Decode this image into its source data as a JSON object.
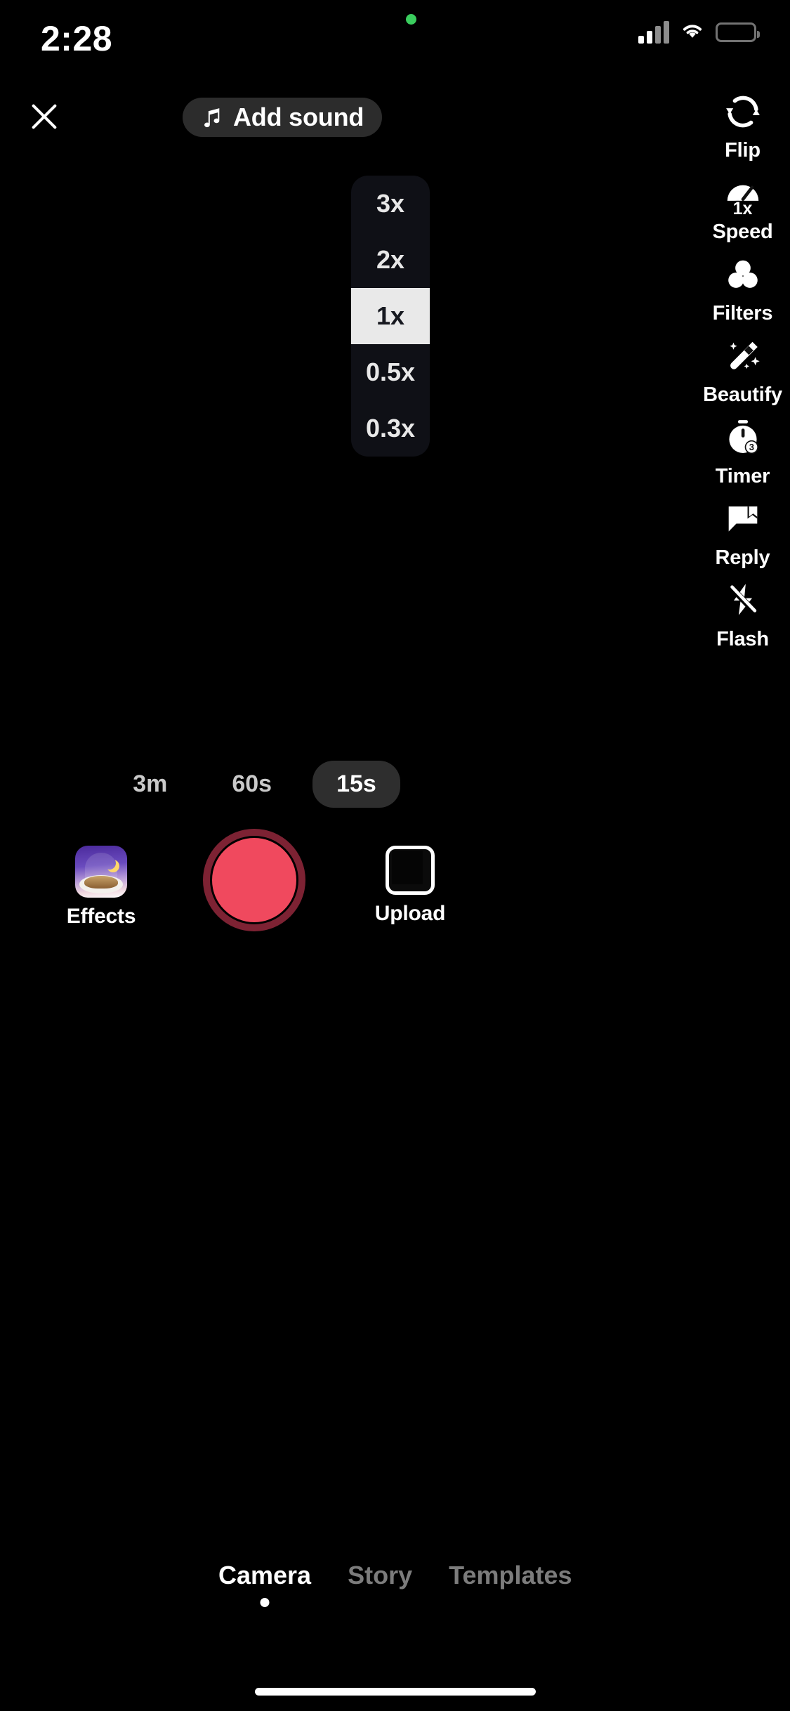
{
  "status_bar": {
    "time": "2:28",
    "recording_dot_color": "#3ACD5E",
    "signal_icon": "cellular-signal-icon",
    "wifi_icon": "wifi-icon",
    "battery_icon": "battery-full-icon"
  },
  "top_bar": {
    "close_label": "close-icon",
    "add_sound_label": "Add sound",
    "add_sound_icon": "music-note-icon"
  },
  "speed_panel": {
    "options": [
      {
        "label": "3x",
        "selected": false
      },
      {
        "label": "2x",
        "selected": false
      },
      {
        "label": "1x",
        "selected": true
      },
      {
        "label": "0.5x",
        "selected": false
      },
      {
        "label": "0.3x",
        "selected": false
      }
    ],
    "selected_value": "1x",
    "bg_color": "#0f1016",
    "selected_bg_color": "#e9e9e9",
    "selected_text_color": "#16181f"
  },
  "sidebar": {
    "items": [
      {
        "label": "Flip",
        "icon": "flip-camera-icon"
      },
      {
        "label": "Speed",
        "icon": "speedometer-icon",
        "badge": "1x"
      },
      {
        "label": "Filters",
        "icon": "filters-icon"
      },
      {
        "label": "Beautify",
        "icon": "magic-wand-icon"
      },
      {
        "label": "Timer",
        "icon": "timer-icon",
        "badge": "3"
      },
      {
        "label": "Reply",
        "icon": "reply-bubble-icon"
      },
      {
        "label": "Flash",
        "icon": "flash-off-icon"
      }
    ]
  },
  "duration": {
    "options": [
      {
        "label": "3m",
        "selected": false
      },
      {
        "label": "60s",
        "selected": false
      },
      {
        "label": "15s",
        "selected": true
      }
    ],
    "selected_value": "15s",
    "selected_bg_color": "#2e2e2e"
  },
  "capture": {
    "effects_label": "Effects",
    "effects_icon": "effects-thumbnail",
    "record_label": "record-button",
    "record_color": "#f0495e",
    "record_ring_color": "#7d2233",
    "upload_label": "Upload",
    "upload_icon": "upload-thumbnail"
  },
  "bottom_tabs": {
    "tabs": [
      {
        "label": "Camera",
        "active": true
      },
      {
        "label": "Story",
        "active": false
      },
      {
        "label": "Templates",
        "active": false
      }
    ],
    "active_color": "#ffffff",
    "inactive_color": "#7c7c7c"
  },
  "home_indicator": "home-indicator"
}
